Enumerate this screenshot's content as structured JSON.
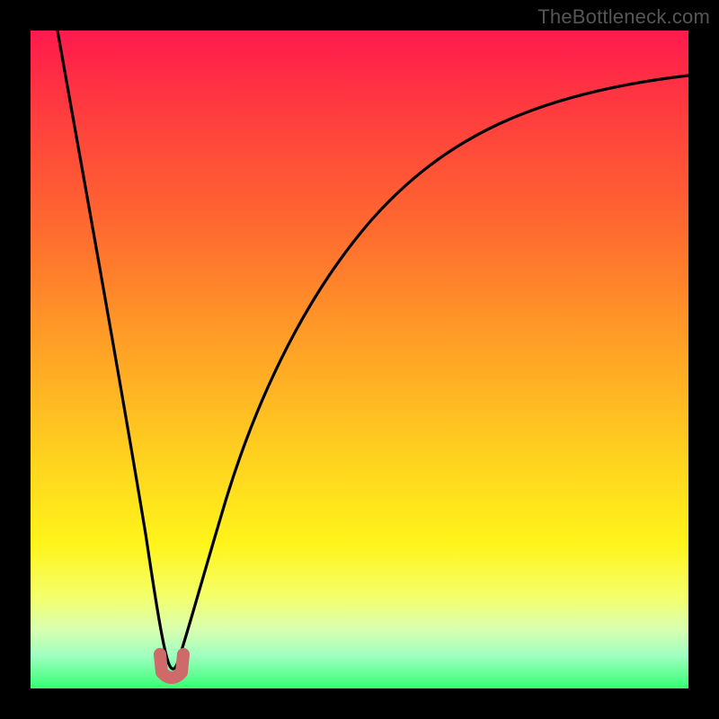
{
  "watermark": "TheBottleneck.com",
  "colors": {
    "frame": "#000000",
    "curve_stroke": "#000000",
    "dip_stroke": "#cf6a6a",
    "gradient_stops": [
      "#ff1a4d",
      "#ff3b3f",
      "#ff6a2f",
      "#ffa126",
      "#ffd21f",
      "#fff41a",
      "#f4ff6a",
      "#d8ffb0",
      "#9fffc0",
      "#35ff74"
    ]
  },
  "chart_data": {
    "type": "line",
    "title": "",
    "xlabel": "",
    "ylabel": "",
    "xlim": [
      0,
      100
    ],
    "ylim": [
      0,
      100
    ],
    "grid": false,
    "legend": false,
    "series": [
      {
        "name": "bottleneck-curve",
        "x": [
          2,
          5,
          8,
          12,
          16,
          19,
          20.5,
          22,
          24,
          28,
          33,
          40,
          48,
          58,
          70,
          85,
          100
        ],
        "y": [
          100,
          80,
          62,
          40,
          20,
          7,
          3,
          7,
          18,
          37,
          53,
          66,
          75,
          82,
          87,
          90,
          92
        ]
      }
    ],
    "annotations": [
      {
        "name": "optimal-dip",
        "shape": "u-marker",
        "x_range": [
          19,
          22
        ],
        "y_range": [
          2,
          6
        ],
        "color": "#cf6a6a"
      }
    ]
  }
}
